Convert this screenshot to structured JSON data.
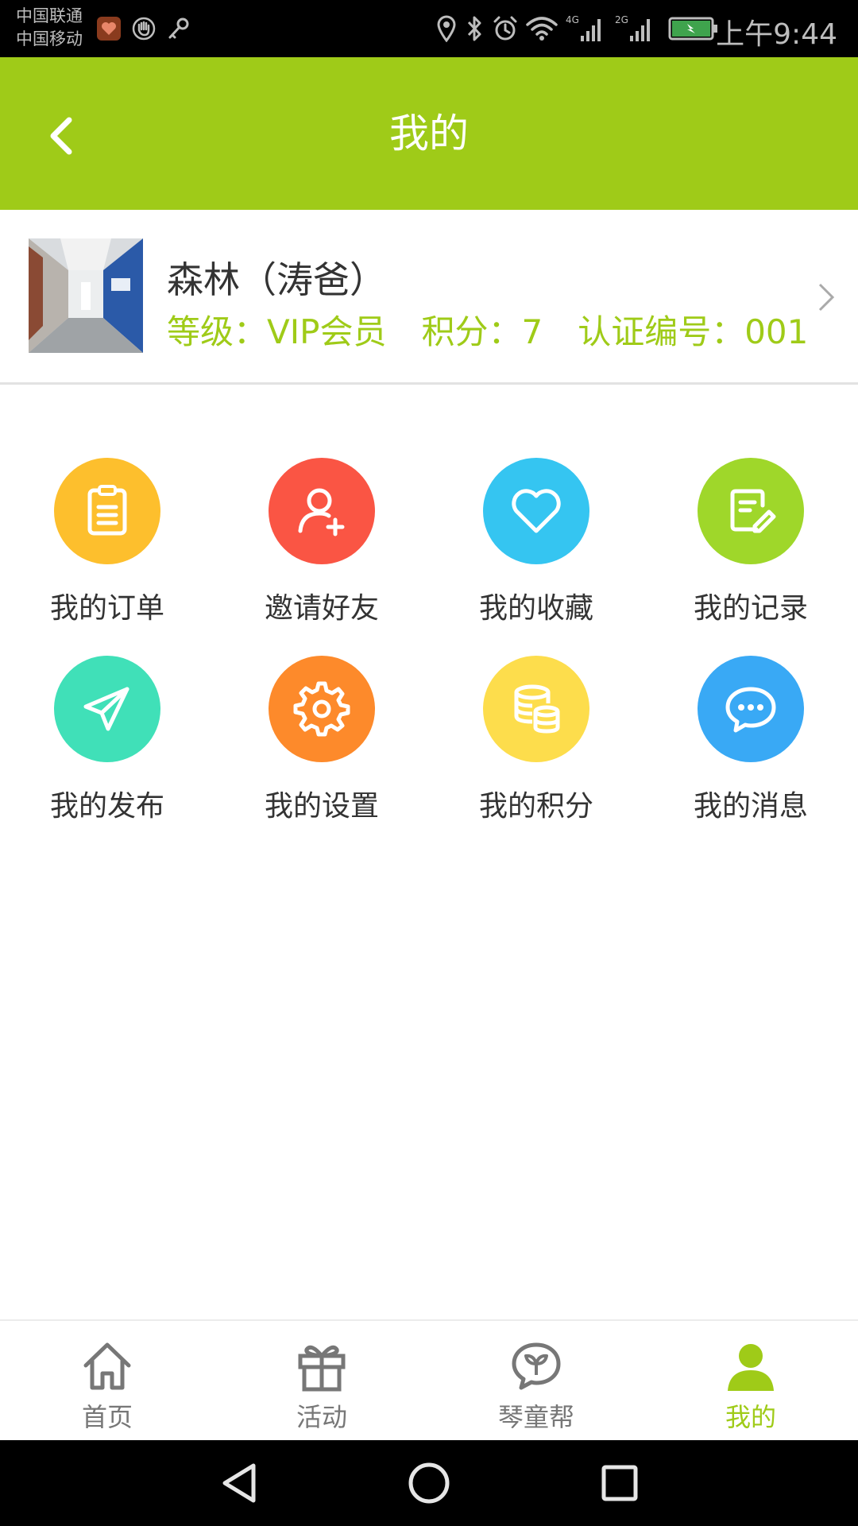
{
  "status_bar": {
    "carrier_1": "中国联通",
    "carrier_2": "中国移动",
    "network_1": "4G",
    "network_2": "2G",
    "time": "上午9:44",
    "icons": [
      "heart-app-icon",
      "hand-icon",
      "key-icon",
      "location-icon",
      "bluetooth-icon",
      "alarm-icon",
      "wifi-icon",
      "signal-icon",
      "signal-icon",
      "battery-icon"
    ]
  },
  "header": {
    "title": "我的",
    "back_icon": "chevron-left-icon",
    "background": "#9fcb18"
  },
  "profile": {
    "name": "森林（涛爸）",
    "level": "等级：VIP会员",
    "points": "积分：7",
    "cert_no": "认证编号：001",
    "accent": "#9fcb18"
  },
  "grid": {
    "items": [
      {
        "label": "我的订单",
        "icon": "clipboard-icon",
        "color": "#fdbf2d"
      },
      {
        "label": "邀请好友",
        "icon": "add-user-icon",
        "color": "#fa5544"
      },
      {
        "label": "我的收藏",
        "icon": "heart-icon",
        "color": "#35c5f1"
      },
      {
        "label": "我的记录",
        "icon": "edit-note-icon",
        "color": "#9fd72a"
      },
      {
        "label": "我的发布",
        "icon": "paper-plane-icon",
        "color": "#40e0b8"
      },
      {
        "label": "我的设置",
        "icon": "gear-icon",
        "color": "#fd8a2b"
      },
      {
        "label": "我的积分",
        "icon": "coins-stack-icon",
        "color": "#fddd4c"
      },
      {
        "label": "我的消息",
        "icon": "chat-bubble-icon",
        "color": "#39a9f5"
      }
    ]
  },
  "bottom_nav": {
    "items": [
      {
        "label": "首页",
        "icon": "home-icon"
      },
      {
        "label": "活动",
        "icon": "gift-icon"
      },
      {
        "label": "琴童帮",
        "icon": "sprout-chat-icon"
      },
      {
        "label": "我的",
        "icon": "user-icon",
        "active": true
      }
    ]
  },
  "system_nav": {
    "icons": [
      "back-triangle-icon",
      "home-circle-icon",
      "recents-square-icon"
    ]
  }
}
